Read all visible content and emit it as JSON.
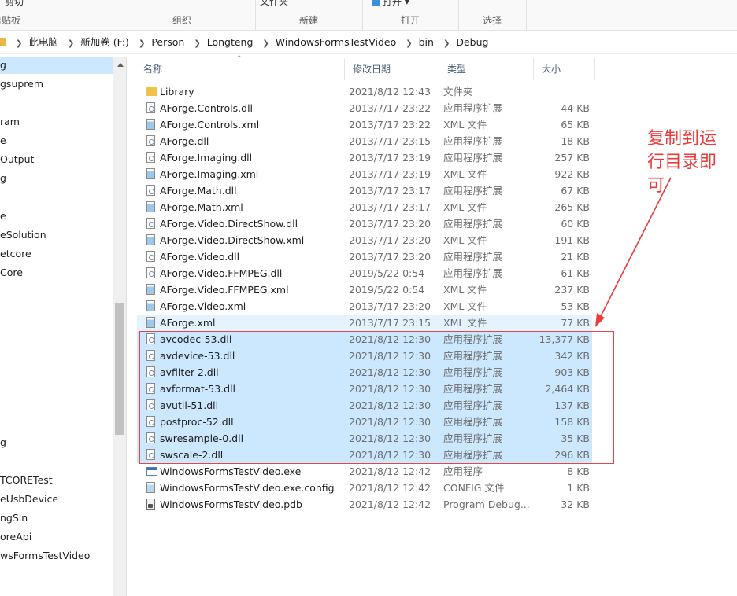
{
  "ribbon": {
    "cut_label": "剪切",
    "clipboard_caption": "剪贴板",
    "organize_caption": "组织",
    "new_caption": "新建",
    "new_item_label": "文件夹",
    "open_label": "打开 ▾",
    "open_caption": "打开",
    "select_caption": "选择"
  },
  "address": {
    "crumbs": [
      "此电脑",
      "新加卷 (F:)",
      "Person",
      "Longteng",
      "WindowsFormsTestVideo",
      "bin",
      "Debug"
    ]
  },
  "nav": {
    "items": [
      {
        "label": "g",
        "selected": true
      },
      {
        "label": "gsuprem"
      },
      {
        "label": ""
      },
      {
        "label": "ram"
      },
      {
        "label": "e"
      },
      {
        "label": "Output"
      },
      {
        "label": "g"
      },
      {
        "label": ""
      },
      {
        "label": "e"
      },
      {
        "label": "eSolution"
      },
      {
        "label": "etcore"
      },
      {
        "label": "Core"
      },
      {
        "label": ""
      },
      {
        "label": ""
      },
      {
        "label": ""
      },
      {
        "label": ""
      },
      {
        "label": ""
      },
      {
        "label": ""
      },
      {
        "label": ""
      },
      {
        "label": ""
      },
      {
        "label": "g"
      },
      {
        "label": ""
      },
      {
        "label": "TCORETest"
      },
      {
        "label": "eUsbDevice"
      },
      {
        "label": "ngSln"
      },
      {
        "label": "oreApi"
      },
      {
        "label": "wsFormsTestVideo"
      }
    ]
  },
  "columns": {
    "name": "名称",
    "date": "修改日期",
    "type": "类型",
    "size": "大小"
  },
  "files": [
    {
      "icon": "folder",
      "name": "Library",
      "date": "2021/8/12 12:43",
      "type": "文件夹",
      "size": "",
      "state": ""
    },
    {
      "icon": "dll",
      "name": "AForge.Controls.dll",
      "date": "2013/7/17 23:22",
      "type": "应用程序扩展",
      "size": "44 KB",
      "state": ""
    },
    {
      "icon": "xml",
      "name": "AForge.Controls.xml",
      "date": "2013/7/17 23:22",
      "type": "XML 文件",
      "size": "65 KB",
      "state": ""
    },
    {
      "icon": "dll",
      "name": "AForge.dll",
      "date": "2013/7/17 23:15",
      "type": "应用程序扩展",
      "size": "18 KB",
      "state": ""
    },
    {
      "icon": "dll",
      "name": "AForge.Imaging.dll",
      "date": "2013/7/17 23:19",
      "type": "应用程序扩展",
      "size": "257 KB",
      "state": ""
    },
    {
      "icon": "xml",
      "name": "AForge.Imaging.xml",
      "date": "2013/7/17 23:19",
      "type": "XML 文件",
      "size": "922 KB",
      "state": ""
    },
    {
      "icon": "dll",
      "name": "AForge.Math.dll",
      "date": "2013/7/17 23:17",
      "type": "应用程序扩展",
      "size": "67 KB",
      "state": ""
    },
    {
      "icon": "xml",
      "name": "AForge.Math.xml",
      "date": "2013/7/17 23:17",
      "type": "XML 文件",
      "size": "265 KB",
      "state": ""
    },
    {
      "icon": "dll",
      "name": "AForge.Video.DirectShow.dll",
      "date": "2013/7/17 23:20",
      "type": "应用程序扩展",
      "size": "60 KB",
      "state": ""
    },
    {
      "icon": "xml",
      "name": "AForge.Video.DirectShow.xml",
      "date": "2013/7/17 23:20",
      "type": "XML 文件",
      "size": "191 KB",
      "state": ""
    },
    {
      "icon": "dll",
      "name": "AForge.Video.dll",
      "date": "2013/7/17 23:20",
      "type": "应用程序扩展",
      "size": "21 KB",
      "state": ""
    },
    {
      "icon": "dll",
      "name": "AForge.Video.FFMPEG.dll",
      "date": "2019/5/22 0:54",
      "type": "应用程序扩展",
      "size": "61 KB",
      "state": ""
    },
    {
      "icon": "xml",
      "name": "AForge.Video.FFMPEG.xml",
      "date": "2019/5/22 0:54",
      "type": "XML 文件",
      "size": "237 KB",
      "state": ""
    },
    {
      "icon": "xml",
      "name": "AForge.Video.xml",
      "date": "2013/7/17 23:20",
      "type": "XML 文件",
      "size": "53 KB",
      "state": ""
    },
    {
      "icon": "xml",
      "name": "AForge.xml",
      "date": "2013/7/17 23:15",
      "type": "XML 文件",
      "size": "77 KB",
      "state": "hover"
    },
    {
      "icon": "dll",
      "name": "avcodec-53.dll",
      "date": "2021/8/12 12:30",
      "type": "应用程序扩展",
      "size": "13,377 KB",
      "state": "selected"
    },
    {
      "icon": "dll",
      "name": "avdevice-53.dll",
      "date": "2021/8/12 12:30",
      "type": "应用程序扩展",
      "size": "342 KB",
      "state": "selected"
    },
    {
      "icon": "dll",
      "name": "avfilter-2.dll",
      "date": "2021/8/12 12:30",
      "type": "应用程序扩展",
      "size": "903 KB",
      "state": "selected"
    },
    {
      "icon": "dll",
      "name": "avformat-53.dll",
      "date": "2021/8/12 12:30",
      "type": "应用程序扩展",
      "size": "2,464 KB",
      "state": "selected"
    },
    {
      "icon": "dll",
      "name": "avutil-51.dll",
      "date": "2021/8/12 12:30",
      "type": "应用程序扩展",
      "size": "137 KB",
      "state": "selected"
    },
    {
      "icon": "dll",
      "name": "postproc-52.dll",
      "date": "2021/8/12 12:30",
      "type": "应用程序扩展",
      "size": "158 KB",
      "state": "selected"
    },
    {
      "icon": "dll",
      "name": "swresample-0.dll",
      "date": "2021/8/12 12:30",
      "type": "应用程序扩展",
      "size": "35 KB",
      "state": "selected"
    },
    {
      "icon": "dll",
      "name": "swscale-2.dll",
      "date": "2021/8/12 12:30",
      "type": "应用程序扩展",
      "size": "296 KB",
      "state": "selected"
    },
    {
      "icon": "exe",
      "name": "WindowsFormsTestVideo.exe",
      "date": "2021/8/12 12:42",
      "type": "应用程序",
      "size": "8 KB",
      "state": ""
    },
    {
      "icon": "config",
      "name": "WindowsFormsTestVideo.exe.config",
      "date": "2021/8/12 12:42",
      "type": "CONFIG 文件",
      "size": "1 KB",
      "state": ""
    },
    {
      "icon": "pdb",
      "name": "WindowsFormsTestVideo.pdb",
      "date": "2021/8/12 12:42",
      "type": "Program Debug...",
      "size": "32 KB",
      "state": ""
    }
  ],
  "annotation": {
    "line1": "复制到运",
    "line2": "行目录即",
    "line3": "可",
    "color": "#ea3a3a"
  }
}
